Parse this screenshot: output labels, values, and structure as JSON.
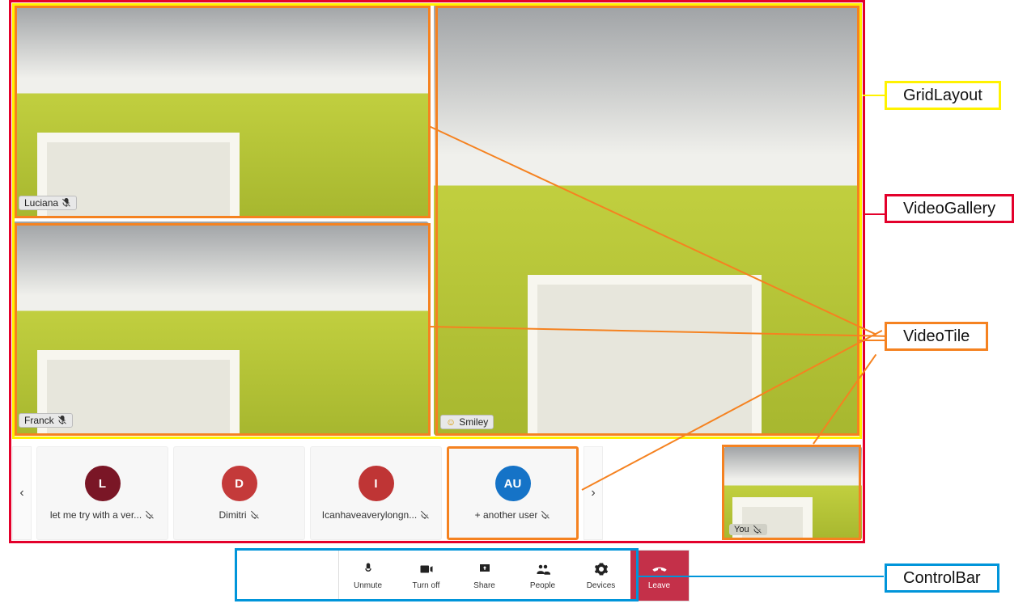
{
  "annotations": {
    "gridlayout": "GridLayout",
    "videogallery": "VideoGallery",
    "videotile": "VideoTile",
    "controlbar": "ControlBar"
  },
  "gallery": {
    "tiles": {
      "luciana": {
        "name": "Luciana",
        "muted": true
      },
      "franck": {
        "name": "Franck",
        "muted": true
      },
      "smiley": {
        "name": "Smiley",
        "muted": false,
        "emoji": true
      }
    }
  },
  "roster": {
    "items": [
      {
        "initial": "L",
        "color": "red-dark",
        "name": "let me try with a ver...",
        "muted": true
      },
      {
        "initial": "D",
        "color": "red",
        "name": "Dimitri",
        "muted": true
      },
      {
        "initial": "I",
        "color": "red2",
        "name": "Icanhaveaverylongn...",
        "muted": true
      },
      {
        "initial": "AU",
        "color": "blue",
        "name": "+ another user",
        "muted": true
      }
    ],
    "self_label": "You",
    "self_muted": true
  },
  "controlbar": {
    "unmute": "Unmute",
    "turnoff": "Turn off",
    "share": "Share",
    "people": "People",
    "devices": "Devices",
    "leave": "Leave"
  }
}
